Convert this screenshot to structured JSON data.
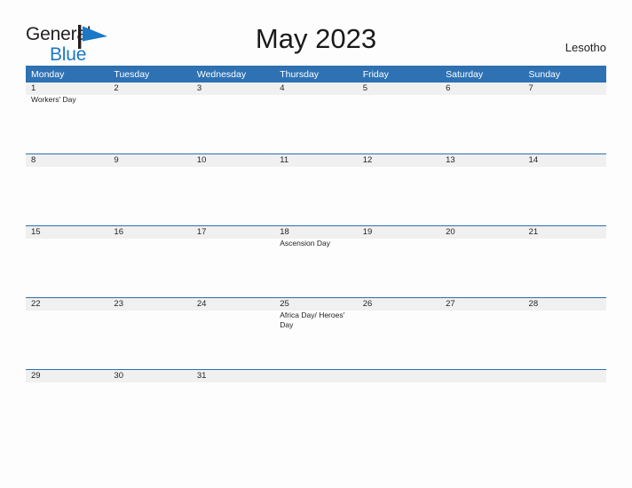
{
  "brand": {
    "name_part1": "General",
    "name_part2": "Blue",
    "flag_icon": "flag-icon"
  },
  "header": {
    "title": "May 2023",
    "country": "Lesotho"
  },
  "colors": {
    "header_blue": "#2e72b4",
    "rule_blue": "#2d6fae",
    "band_gray": "#f0f0f0",
    "logo_blue": "#1b78c6",
    "text_dark": "#231f20",
    "page_background": "#fdfdfd"
  },
  "calendar": {
    "month": "May",
    "year": "2023",
    "weekday_headers": [
      "Monday",
      "Tuesday",
      "Wednesday",
      "Thursday",
      "Friday",
      "Saturday",
      "Sunday"
    ],
    "weeks": [
      [
        {
          "day": "1",
          "events": [
            "Workers' Day"
          ]
        },
        {
          "day": "2",
          "events": []
        },
        {
          "day": "3",
          "events": []
        },
        {
          "day": "4",
          "events": []
        },
        {
          "day": "5",
          "events": []
        },
        {
          "day": "6",
          "events": []
        },
        {
          "day": "7",
          "events": []
        }
      ],
      [
        {
          "day": "8",
          "events": []
        },
        {
          "day": "9",
          "events": []
        },
        {
          "day": "10",
          "events": []
        },
        {
          "day": "11",
          "events": []
        },
        {
          "day": "12",
          "events": []
        },
        {
          "day": "13",
          "events": []
        },
        {
          "day": "14",
          "events": []
        }
      ],
      [
        {
          "day": "15",
          "events": []
        },
        {
          "day": "16",
          "events": []
        },
        {
          "day": "17",
          "events": []
        },
        {
          "day": "18",
          "events": [
            "Ascension Day"
          ]
        },
        {
          "day": "19",
          "events": []
        },
        {
          "day": "20",
          "events": []
        },
        {
          "day": "21",
          "events": []
        }
      ],
      [
        {
          "day": "22",
          "events": []
        },
        {
          "day": "23",
          "events": []
        },
        {
          "day": "24",
          "events": []
        },
        {
          "day": "25",
          "events": [
            "Africa Day/ Heroes' Day"
          ]
        },
        {
          "day": "26",
          "events": []
        },
        {
          "day": "27",
          "events": []
        },
        {
          "day": "28",
          "events": []
        }
      ],
      [
        {
          "day": "29",
          "events": []
        },
        {
          "day": "30",
          "events": []
        },
        {
          "day": "31",
          "events": []
        },
        {
          "day": "",
          "events": []
        },
        {
          "day": "",
          "events": []
        },
        {
          "day": "",
          "events": []
        },
        {
          "day": "",
          "events": []
        }
      ]
    ]
  }
}
